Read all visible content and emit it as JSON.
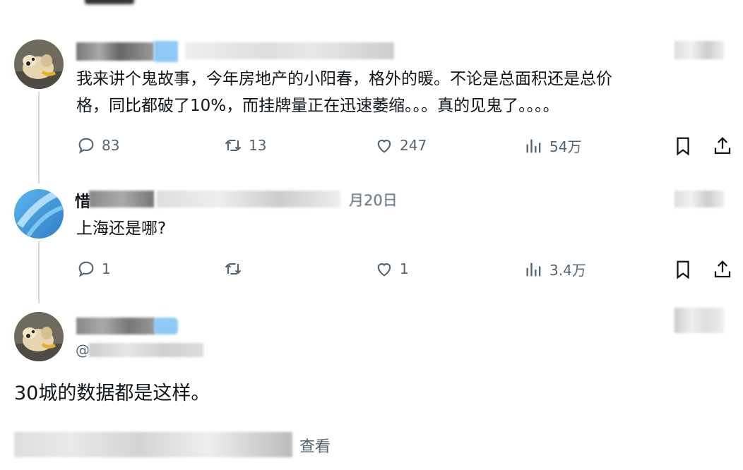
{
  "top_fragment": "…",
  "tweets": [
    {
      "text_line1": "我来讲个鬼故事，今年房地产的小阳春，格外的暖。不论是总面积还是总价",
      "text_line2": "格，同比都破了10%，而挂牌量正在迅速萎缩。。。真的见鬼了。。。。",
      "replies": "83",
      "retweets": "13",
      "likes": "247",
      "views": "54万",
      "avatar_icon": "dog-avatar-icon"
    },
    {
      "header_visible": "惜",
      "header_date": "月20日",
      "text": "上海还是哪?",
      "replies": "1",
      "retweets": "",
      "likes": "1",
      "views": "3.4万",
      "avatar_icon": "blue-abstract-avatar-icon"
    },
    {
      "handle_prefix": "@",
      "text": "30城的数据都是这样。",
      "avatar_icon": "dog-avatar-icon"
    }
  ],
  "footer": {
    "view_label": "查看"
  },
  "colors": {
    "text": "#0f1419",
    "secondary": "#536471",
    "thread_line": "#cfd9de",
    "verified_blue": "#8ec9f5"
  }
}
